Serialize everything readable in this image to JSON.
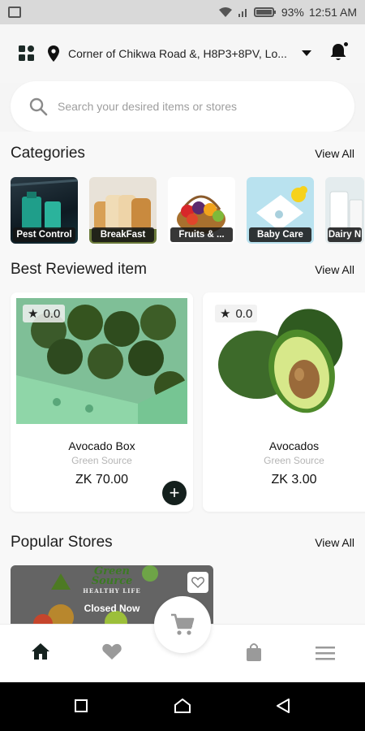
{
  "status_bar": {
    "battery": "93%",
    "time": "12:51 AM"
  },
  "header": {
    "location": "Corner of Chikwa Road &, H8P3+8PV, Lo..."
  },
  "search": {
    "placeholder": "Search your desired items or stores"
  },
  "categories": {
    "title": "Categories",
    "view_all": "View All",
    "items": [
      {
        "label": "Pest Control"
      },
      {
        "label": "BreakFast"
      },
      {
        "label": "Fruits & ..."
      },
      {
        "label": "Baby Care"
      },
      {
        "label": "Dairy N"
      }
    ]
  },
  "best_reviewed": {
    "title": "Best Reviewed item",
    "view_all": "View All",
    "items": [
      {
        "rating": "0.0",
        "name": "Avocado Box",
        "source": "Green Source",
        "price": "ZK 70.00"
      },
      {
        "rating": "0.0",
        "name": "Avocados",
        "source": "Green Source",
        "price": "ZK 3.00"
      }
    ]
  },
  "popular_stores": {
    "title": "Popular Stores",
    "view_all": "View All",
    "items": [
      {
        "banner_line1": "Green",
        "banner_line2": "Source",
        "banner_line3": "HEALTHY LIFE",
        "status": "Closed Now"
      }
    ]
  },
  "icons": {
    "menu_grid": "grid-icon",
    "location": "location-pin-icon",
    "dropdown": "caret-down-icon",
    "notifications": "bell-icon",
    "search": "search-icon",
    "home": "home-icon",
    "favorites": "heart-icon",
    "cart": "cart-icon",
    "orders": "bag-icon",
    "menu": "hamburger-icon"
  },
  "colors": {
    "accent_dark": "#14201d",
    "muted": "#9e9e9e"
  }
}
